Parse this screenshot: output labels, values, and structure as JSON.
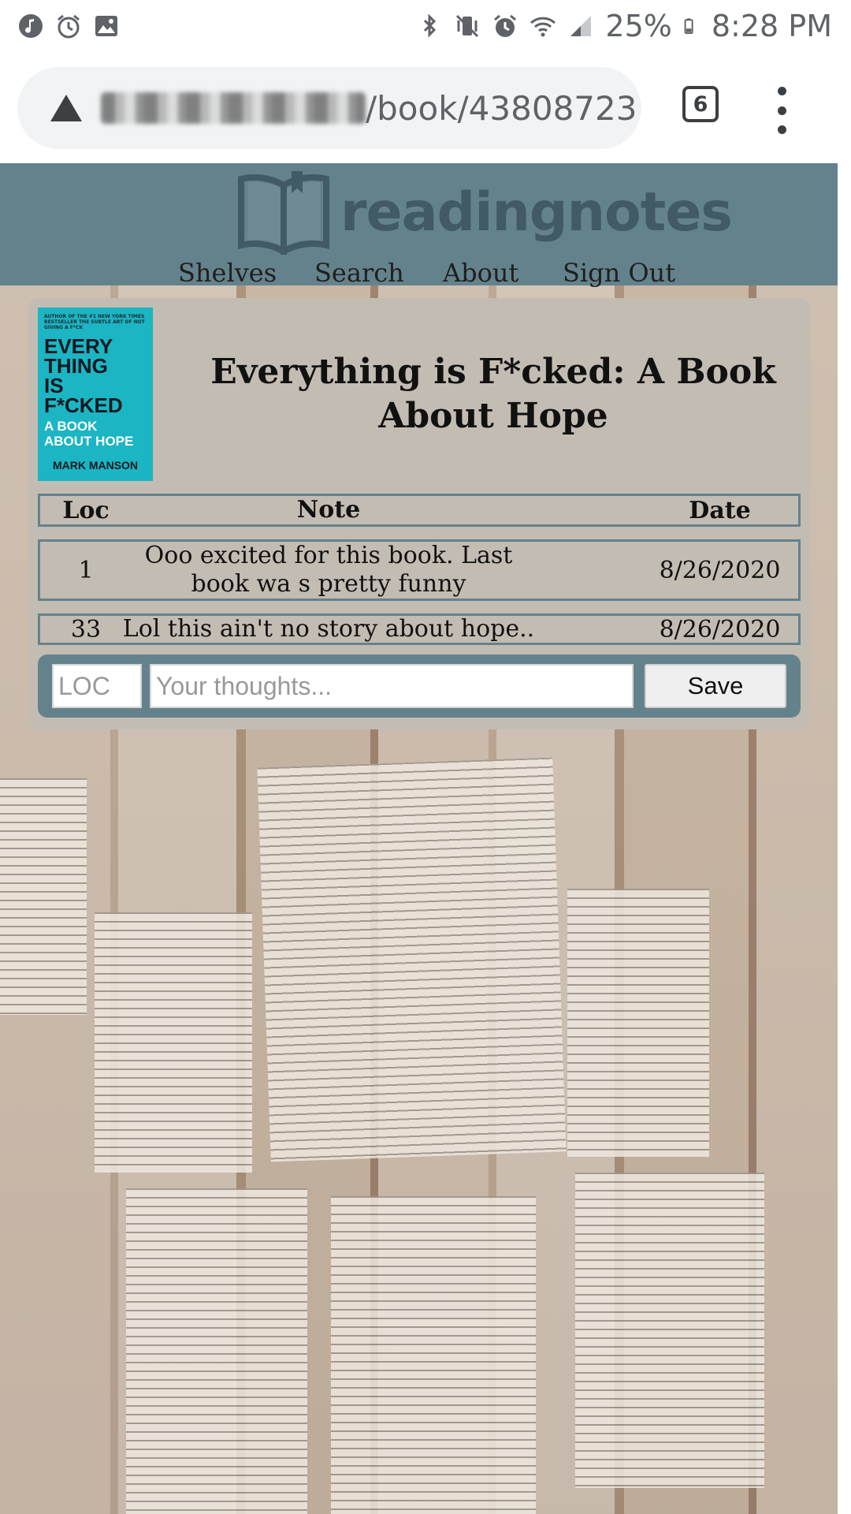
{
  "status_bar": {
    "left_icons": [
      "music-note-icon",
      "alarm-icon",
      "image-icon"
    ],
    "right_icons": [
      "bluetooth-icon",
      "vibrate-mute-icon",
      "alarm-icon",
      "wifi-icon",
      "signal-icon"
    ],
    "battery": "25%",
    "time": "8:28 PM"
  },
  "browser": {
    "url_visible": "/book/43808723",
    "tab_count": "6"
  },
  "site": {
    "logo_text": "readingnotes",
    "nav": [
      "Shelves",
      "Search",
      "About",
      "Sign Out"
    ],
    "colors": {
      "header": "#64828c",
      "card": "#c3bcb2",
      "logo": "#415a63"
    }
  },
  "book": {
    "title": "Everything is F*cked: A Book About Hope",
    "cover": {
      "tagline": "AUTHOR OF THE #1 NEW YORK TIMES BESTSELLER THE SUBTLE ART OF NOT GIVING A F*CK",
      "title_lines": [
        "EVERY",
        "THING",
        "IS",
        "F*CKED"
      ],
      "subtitle_lines": [
        "A BOOK",
        "ABOUT HOPE"
      ],
      "author": "MARK MANSON"
    }
  },
  "notes": {
    "headers": {
      "loc": "Loc",
      "note": "Note",
      "date": "Date"
    },
    "rows": [
      {
        "loc": "1",
        "note": "Ooo excited for this book. Last book wa s pretty funny",
        "date": "8/26/2020"
      },
      {
        "loc": "33",
        "note": "Lol this ain't no story about hope..",
        "date": "8/26/2020"
      }
    ]
  },
  "form": {
    "loc_placeholder": "LOC",
    "thoughts_placeholder": "Your thoughts...",
    "save_label": "Save"
  }
}
